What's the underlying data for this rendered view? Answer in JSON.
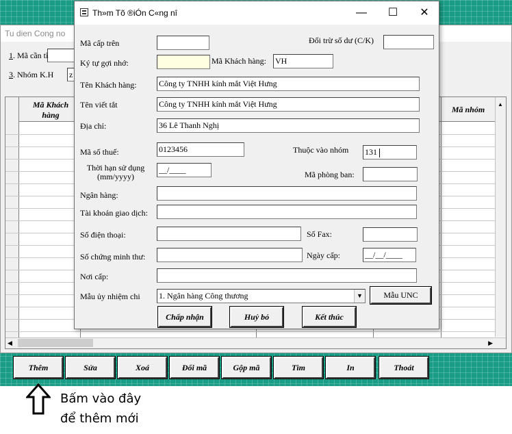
{
  "main_window": {
    "title": "Tu dien Cong no",
    "ma_can_tim_num": "1",
    "ma_can_tim_label": ". Mã cần tìm:",
    "nhom_kh_num": "3",
    "nhom_kh_label": ". Nhóm K.H",
    "nhom_kh_value": "z",
    "grid_headers": [
      "Mã Khách hàng",
      "Mã nhóm"
    ]
  },
  "dialog": {
    "title": "Th»m Tõ ®iÓn C«ng nî",
    "fields": {
      "ma_cap_tren": {
        "label": "Mã cấp trên",
        "value": ""
      },
      "doi_tru_so_du": {
        "label": "Đối trừ số dư (C/K)",
        "value": ""
      },
      "ky_tu_goi_nho": {
        "label": "Ký tự gợi nhớ:",
        "value": ""
      },
      "ma_khach_hang": {
        "label": "Mã Khách hàng:",
        "value": "VH"
      },
      "ten_khach_hang": {
        "label": "Tên Khách hàng:",
        "value": "Công ty TNHH kính mắt Việt Hưng"
      },
      "ten_viet_tat": {
        "label": "Tên viết tắt",
        "value": "Công ty TNHH kính mắt Việt Hưng"
      },
      "dia_chi": {
        "label": "Địa chỉ:",
        "value": "36 Lê Thanh Nghị"
      },
      "ma_so_thue": {
        "label": "Mã số thuế:",
        "value": "0123456"
      },
      "thuoc_vao_nhom": {
        "label": "Thuộc vào nhóm",
        "value": "131"
      },
      "thoi_han_su_dung": {
        "label_line1": "Thời hạn sử dụng",
        "label_line2": "(mm/yyyy)",
        "value": "__/____"
      },
      "ma_phong_ban": {
        "label": "Mã phòng ban:",
        "value": ""
      },
      "ngan_hang": {
        "label": "Ngân hàng:",
        "value": ""
      },
      "tai_khoan_giao_dich": {
        "label": "Tài khoản giao dịch:",
        "value": ""
      },
      "so_dien_thoai": {
        "label": "Số điện thoại:",
        "value": ""
      },
      "so_fax": {
        "label": "Số Fax:",
        "value": ""
      },
      "so_chung_minh_thu": {
        "label": "Số chứng minh thư:",
        "value": ""
      },
      "ngay_cap": {
        "label": "Ngày cấp:",
        "value": "__/__/____"
      },
      "noi_cap": {
        "label": "Nơi cấp:",
        "value": ""
      },
      "mau_uy_nhiem_chi": {
        "label": "Mẫu ủy nhiệm chi",
        "value": "1. Ngân hàng Công thương"
      }
    },
    "buttons": {
      "mau_unc": "Mẫu UNC",
      "chap_nhan": "Chấp nhận",
      "huy_bo": "Huỷ bỏ",
      "ket_thuc": "Kết thúc"
    }
  },
  "bottom_buttons": [
    "Thêm",
    "Sửa",
    "Xoá",
    "Đổi mã",
    "Gộp mã",
    "Tìm",
    "In",
    "Thoát"
  ],
  "annotation": {
    "line1": "Bấm vào đây",
    "line2": "để thêm mới"
  }
}
